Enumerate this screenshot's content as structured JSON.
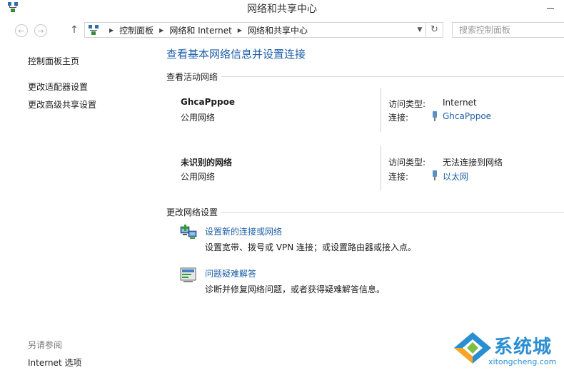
{
  "window": {
    "title": "网络和共享中心"
  },
  "addressbar": {
    "crumbs": [
      "控制面板",
      "网络和 Internet",
      "网络和共享中心"
    ]
  },
  "search": {
    "placeholder": "搜索控制面板"
  },
  "sidebar": {
    "items": [
      {
        "label": "控制面板主页"
      },
      {
        "label": "更改适配器设置"
      },
      {
        "label": "更改高级共享设置"
      }
    ],
    "see_also_heading": "另请参阅",
    "see_also_items": [
      {
        "label": "Internet 选项"
      }
    ]
  },
  "main": {
    "title": "查看基本网络信息并设置连接",
    "active_networks_header": "查看活动网络",
    "networks": [
      {
        "name": "GhcaPppoe",
        "type": "公用网络",
        "access_label": "访问类型:",
        "access_value": "Internet",
        "connection_label": "连接:",
        "connection_value": "GhcaPppoe"
      },
      {
        "name": "未识别的网络",
        "type": "公用网络",
        "access_label": "访问类型:",
        "access_value": "无法连接到网络",
        "connection_label": "连接:",
        "connection_value": "以太网"
      }
    ],
    "change_settings_header": "更改网络设置",
    "tasks": [
      {
        "link": "设置新的连接或网络",
        "description": "设置宽带、拨号或 VPN 连接；或设置路由器或接入点。",
        "icon": "network-setup-icon"
      },
      {
        "link": "问题疑难解答",
        "description": "诊断并修复网络问题，或者获得疑难解答信息。",
        "icon": "troubleshoot-icon"
      }
    ]
  },
  "watermark": {
    "text": "系统城",
    "url": "xitongcheng.com"
  },
  "colors": {
    "link": "#1f5fa8",
    "watermark": "#2a8ed2"
  }
}
